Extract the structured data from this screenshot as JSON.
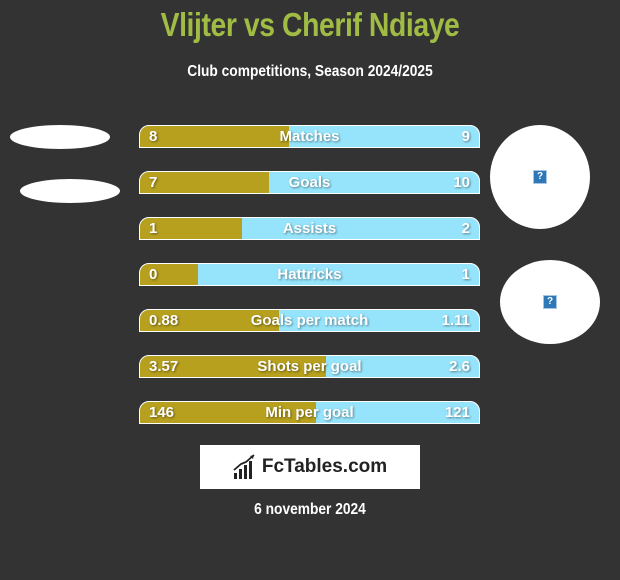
{
  "header": {
    "title": "Vlijter vs Cherif Ndiaye",
    "subtitle": "Club competitions, Season 2024/2025"
  },
  "colors": {
    "title": "#a0bc44",
    "left_player": "#b7a01e",
    "right_player": "#96e4fb",
    "background": "#333333"
  },
  "players": {
    "left": {
      "name": "Vlijter",
      "image_icon": "ellipse-placeholder"
    },
    "right": {
      "name": "Cherif Ndiaye",
      "image_icon": "broken-image-icon",
      "club_icon": "broken-image-icon"
    }
  },
  "stats": [
    {
      "label": "Matches",
      "left": "8",
      "right": "9",
      "left_share": 0.44
    },
    {
      "label": "Goals",
      "left": "7",
      "right": "10",
      "left_share": 0.38
    },
    {
      "label": "Assists",
      "left": "1",
      "right": "2",
      "left_share": 0.3
    },
    {
      "label": "Hattricks",
      "left": "0",
      "right": "1",
      "left_share": 0.17
    },
    {
      "label": "Goals per match",
      "left": "0.88",
      "right": "1.11",
      "left_share": 0.41
    },
    {
      "label": "Shots per goal",
      "left": "3.57",
      "right": "2.6",
      "left_share": 0.55
    },
    {
      "label": "Min per goal",
      "left": "146",
      "right": "121",
      "left_share": 0.52
    }
  ],
  "footer": {
    "logo_text": "FcTables.com",
    "date": "6 november 2024"
  }
}
